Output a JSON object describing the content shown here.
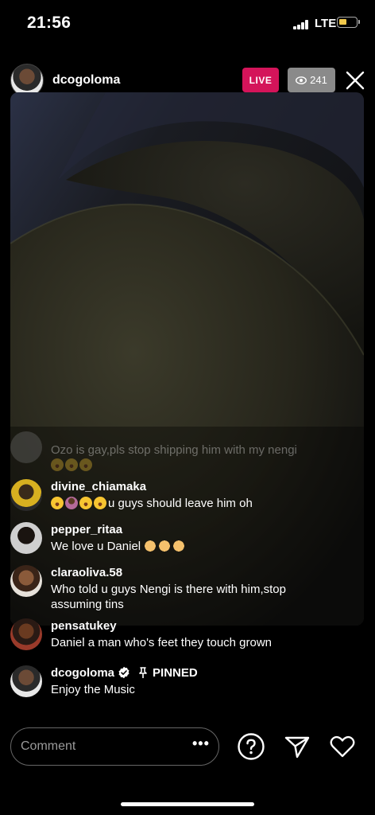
{
  "status_bar": {
    "time": "21:56",
    "network": "LTE"
  },
  "header": {
    "username": "dcogoloma",
    "live_label": "LIVE",
    "viewer_count": "241"
  },
  "comments": [
    {
      "username": "",
      "text": "Ozo is gay,pls stop shipping him with my nengi",
      "emojis": [
        "laugh",
        "laugh",
        "laugh"
      ],
      "faded": true
    },
    {
      "username": "divine_chiamaka",
      "text": "u guys should leave him oh"
    },
    {
      "username": "pepper_ritaa",
      "text": "We love u Daniel"
    },
    {
      "username": "claraoliva.58",
      "text": "Who told u guys Nengi is there with him,stop assuming tins"
    },
    {
      "username": "pensatukey",
      "text": "Daniel a man who's feet they touch grown"
    }
  ],
  "pinned": {
    "username": "dcogoloma",
    "label": "PINNED",
    "text": "Enjoy the Music"
  },
  "bottom_bar": {
    "comment_placeholder": "Comment",
    "more_label": "•••"
  },
  "colors": {
    "live": "#d4145a",
    "viewer_badge": "#8a8a8a",
    "battery": "#f2c94c"
  }
}
